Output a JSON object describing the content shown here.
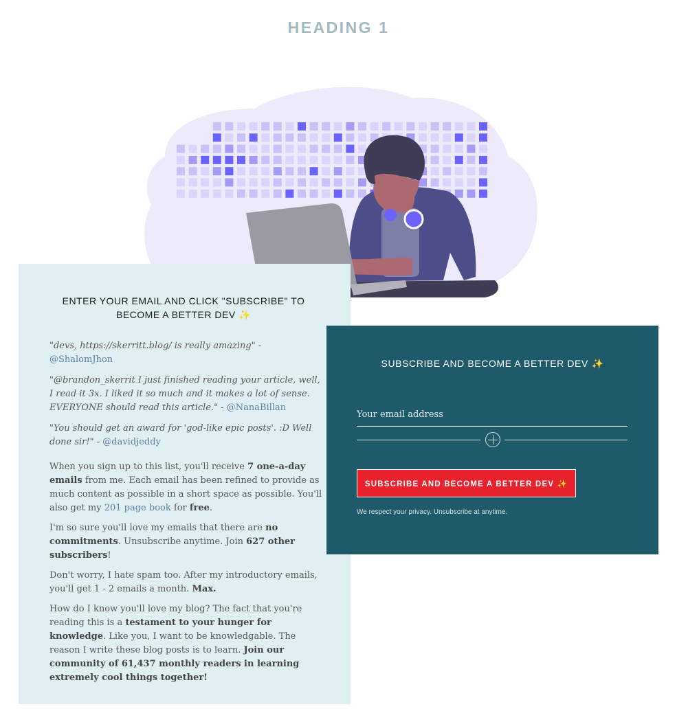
{
  "heading": "HEADING 1",
  "left_panel": {
    "title": "ENTER YOUR EMAIL AND CLICK \"SUBSCRIBE\" TO BECOME A BETTER DEV",
    "title_emoji": "✨",
    "quotes": [
      {
        "text": "\"devs, https://skerritt.blog/  is really amazing\" - ",
        "handle": "@ShalomJhon"
      },
      {
        "text": "\"@brandon_skerrit I just finished reading your article, well, I read it 3x. I liked it so much and it makes a lot of sense. EVERYONE should read this article.\" - ",
        "handle": "@NanaBillan"
      },
      {
        "text": "\"You should get an award for 'god-like epic posts'. :D Well done sir!\" - ",
        "handle": "@davidjeddy"
      }
    ],
    "p1": {
      "t1": "When you sign up to this list, you'll receive ",
      "b1": "7 one-a-day emails",
      "t2": " from me. Each email has been refined to provide as much content as possible in a short space as possible. You'll also get my ",
      "link": "201 page book",
      "t3": " for ",
      "b2": "free",
      "t4": "."
    },
    "p2": {
      "t1": "I'm so sure you'll love my emails that there are ",
      "b1": "no commitments",
      "t2": ". Unsubscribe anytime. Join ",
      "b2": "627 other subscribers",
      "t3": "!"
    },
    "p3": {
      "t1": "Don't worry, I hate spam too. After my introductory emails, you'll get 1 - 2 emails a month. ",
      "b1": "Max."
    },
    "p4": {
      "t1": "How do I know you'll love my blog? The fact that you're reading this is a ",
      "b1": "testament to your hunger for knowledge",
      "t2": ". Like you, I want to be knowledgable. The reason I write these blog posts is to learn. ",
      "b2": "Join our community of 61,437 monthly readers in learning extremely cool things together!"
    }
  },
  "right_panel": {
    "title": "SUBSCRIBE AND BECOME A BETTER DEV",
    "title_emoji": "✨",
    "email_placeholder": "Your email address",
    "button_label": "SUBSCRIBE AND BECOME A BETTER DEV",
    "button_emoji": "✨",
    "privacy": "We respect your privacy. Unsubscribe at anytime."
  },
  "colors": {
    "heading": "#a3b8c0",
    "left_bg": "#e0eff2",
    "right_bg": "#1f5a6a",
    "button": "#e8222c",
    "link": "#5a7fa6",
    "illustration_accent": "#6c63ff"
  },
  "icons": {
    "illustration": "developer-at-laptop-illustration",
    "divider": "crosshair-circle-icon",
    "emoji": "sparkles-icon"
  }
}
